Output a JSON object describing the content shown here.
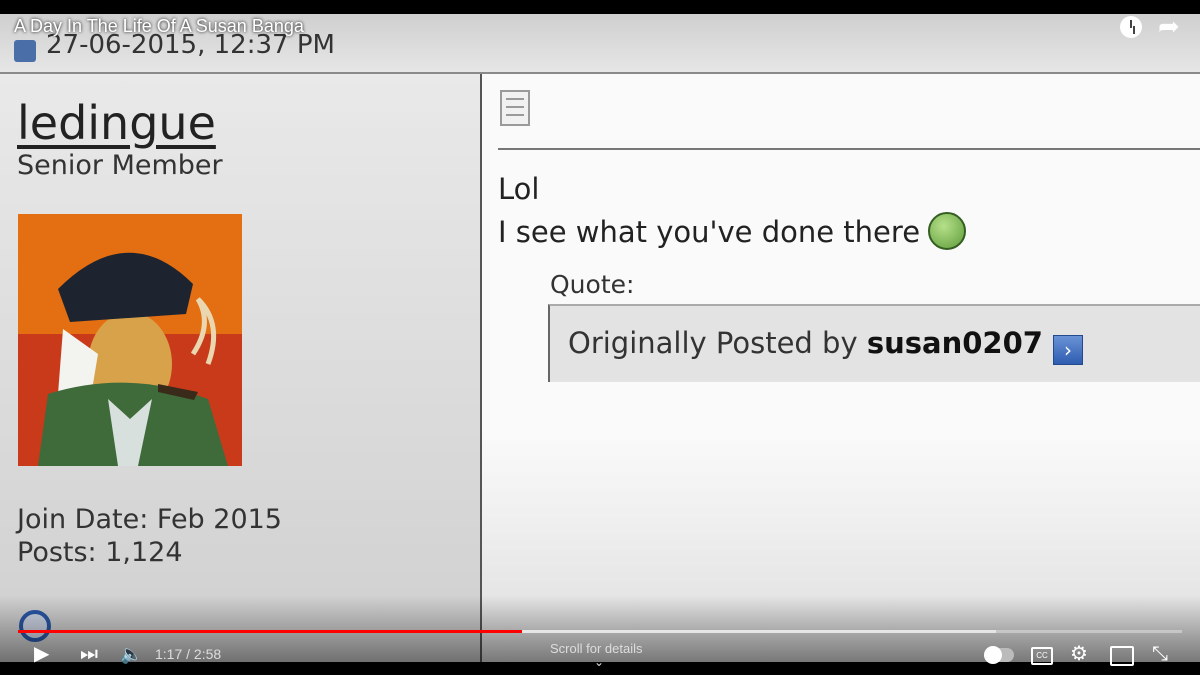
{
  "video": {
    "title": "A Day In The Life Of A Susan Banga",
    "current_time": "1:17",
    "duration": "2:58",
    "time_display": "1:17 / 2:58",
    "progress_fraction": 0.433,
    "buffered_fraction": 0.84,
    "scroll_hint": "Scroll for details"
  },
  "forum_post": {
    "date": "27-06-2015, 12:37 PM",
    "username": "ledingue",
    "user_title": "Senior Member",
    "join_date": "Join Date: Feb 2015",
    "posts": "Posts: 1,124",
    "message_line1": "Lol",
    "message_line2": "I see what you've done there",
    "quote_label": "Quote:",
    "quote_prefix": "Originally Posted by",
    "quote_author": "susan0207"
  },
  "icons": {
    "clock": "watch-later-icon",
    "share": "share-icon",
    "play": "play-icon",
    "next": "next-icon",
    "volume": "volume-icon",
    "settings": "gear-icon",
    "cast": "cast-icon",
    "fullscreen": "exit-fullscreen-icon"
  },
  "colors": {
    "progress_played": "#ff0000",
    "link_blue": "#2b58a8"
  }
}
